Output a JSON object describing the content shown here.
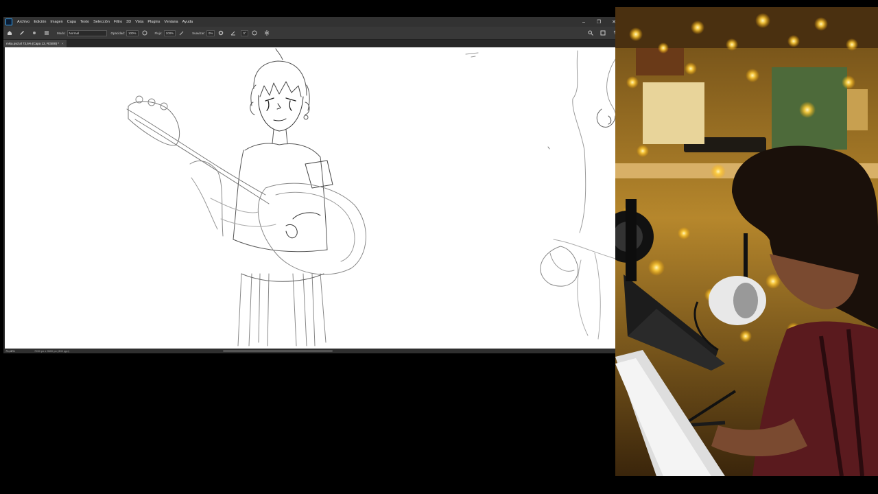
{
  "app": {
    "name": "Photoshop",
    "logo_text": "Ps",
    "menu": [
      "Archivo",
      "Edición",
      "Imagen",
      "Capa",
      "Texto",
      "Selección",
      "Filtro",
      "3D",
      "Vista",
      "Plugins",
      "Ventana",
      "Ayuda"
    ]
  },
  "options": {
    "mode_label": "Modo:",
    "mode_value": "Normal",
    "opacity_label": "Opacidad:",
    "opacity_value": "100%",
    "flow_label": "Flujo:",
    "flow_value": "100%",
    "smoothing_label": "Suavizar:",
    "smoothing_value": "0%",
    "angle_value": "0°"
  },
  "document": {
    "tab_title": "mika.psd al 73,5% (Capa 13, RGB/8) *",
    "tab_close": "×"
  },
  "status": {
    "zoom": "73,48%",
    "doc_info": "7200 px x 9600 px (300 ppp)"
  },
  "window_controls": {
    "minimize": "–",
    "restore": "❐",
    "close": "✕"
  },
  "colors": {
    "ui_dark": "#2b2b2b",
    "menubar": "#323232",
    "accent": "#31a8ff",
    "canvas": "#ffffff",
    "webcam_light": "#ffd35a"
  }
}
